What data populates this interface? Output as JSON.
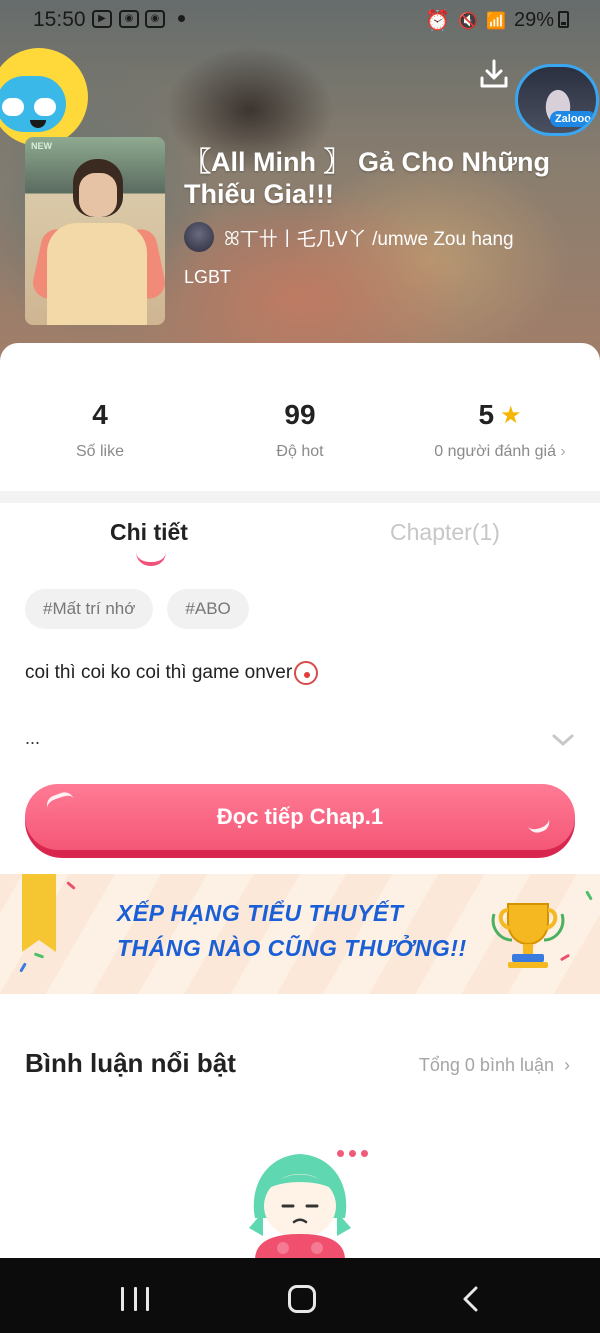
{
  "status_bar": {
    "time": "15:50",
    "battery_percent": "29%",
    "icons": [
      "youtube-icon",
      "app-icon",
      "app-icon",
      "dot",
      "alarm-icon",
      "mute-icon",
      "wifi-icon",
      "signal-icon",
      "battery-icon"
    ]
  },
  "hero": {
    "title": "〖All Minh 〗 Gả Cho Những Thiếu Gia!!!",
    "author": "ꕤ丅卄丨乇几ᐯ丫 /umwe Zou hang",
    "genre": "LGBT",
    "cover_badge": "NEW",
    "top_avatar_badge": "Zalooo",
    "icons": {
      "download": "download-icon",
      "mascot": "app-mascot-icon"
    }
  },
  "stats": {
    "likes": {
      "value": "4",
      "label": "Số like"
    },
    "hot": {
      "value": "99",
      "label": "Độ hot"
    },
    "rating": {
      "value": "5",
      "label": "0 người đánh giá"
    }
  },
  "tabs": {
    "detail": "Chi tiết",
    "chapter": "Chapter(1)",
    "active": "detail"
  },
  "tags": [
    "#Mất trí nhớ",
    "#ABO"
  ],
  "description": {
    "text": "coi thì coi ko coi thì game onver",
    "ellipsis": "..."
  },
  "read_button": {
    "label": "Đọc tiếp Chap.1"
  },
  "banner": {
    "line1": "XẾP HẠNG TIỂU THUYẾT",
    "line2": "THÁNG NÀO CŨNG THƯỞNG!!"
  },
  "comments": {
    "title": "Bình luận nổi bật",
    "total": "Tổng 0 bình luận"
  },
  "colors": {
    "accent": "#f45776",
    "banner_text": "#1a5fd6",
    "star": "#f7b500"
  }
}
